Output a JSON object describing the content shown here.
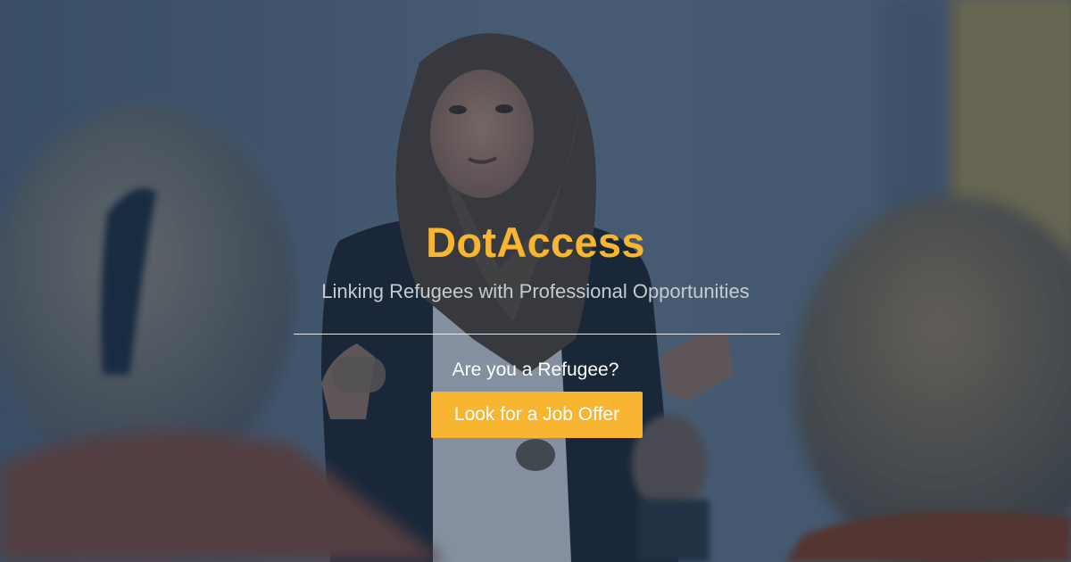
{
  "hero": {
    "brand": "DotAccess",
    "tagline": "Linking Refugees with Professional Opportunities",
    "question": "Are you a Refugee?",
    "cta_label": "Look for a Job Offer"
  },
  "colors": {
    "brand": "#f7b531",
    "tagline": "#c7cbd1",
    "question": "#ffffff",
    "cta_background": "#f7b531",
    "cta_text": "#ffffff"
  }
}
